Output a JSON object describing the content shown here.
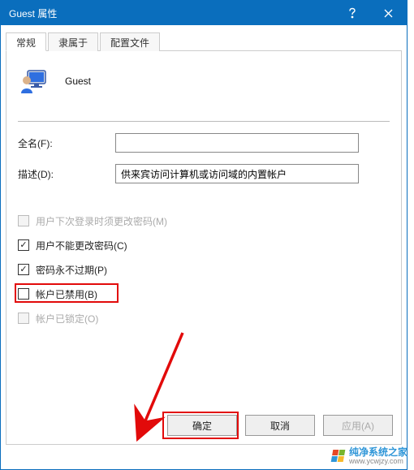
{
  "window": {
    "title": "Guest 属性"
  },
  "tabs": [
    {
      "label": "常规"
    },
    {
      "label": "隶属于"
    },
    {
      "label": "配置文件"
    }
  ],
  "user": {
    "name": "Guest"
  },
  "fields": {
    "fullname": {
      "label": "全名(F):",
      "value": ""
    },
    "description": {
      "label": "描述(D):",
      "value": "供来宾访问计算机或访问域的内置帐户"
    }
  },
  "checkboxes": {
    "must_change": {
      "label": "用户下次登录时须更改密码(M)"
    },
    "cannot_change": {
      "label": "用户不能更改密码(C)"
    },
    "never_expire": {
      "label": "密码永不过期(P)"
    },
    "disabled_acc": {
      "label": "帐户已禁用(B)"
    },
    "locked": {
      "label": "帐户已锁定(O)"
    }
  },
  "buttons": {
    "ok": "确定",
    "cancel": "取消",
    "apply": "应用(A)"
  },
  "watermark": {
    "line1": "纯净系统之家",
    "line2": "www.ycwjzy.com"
  }
}
